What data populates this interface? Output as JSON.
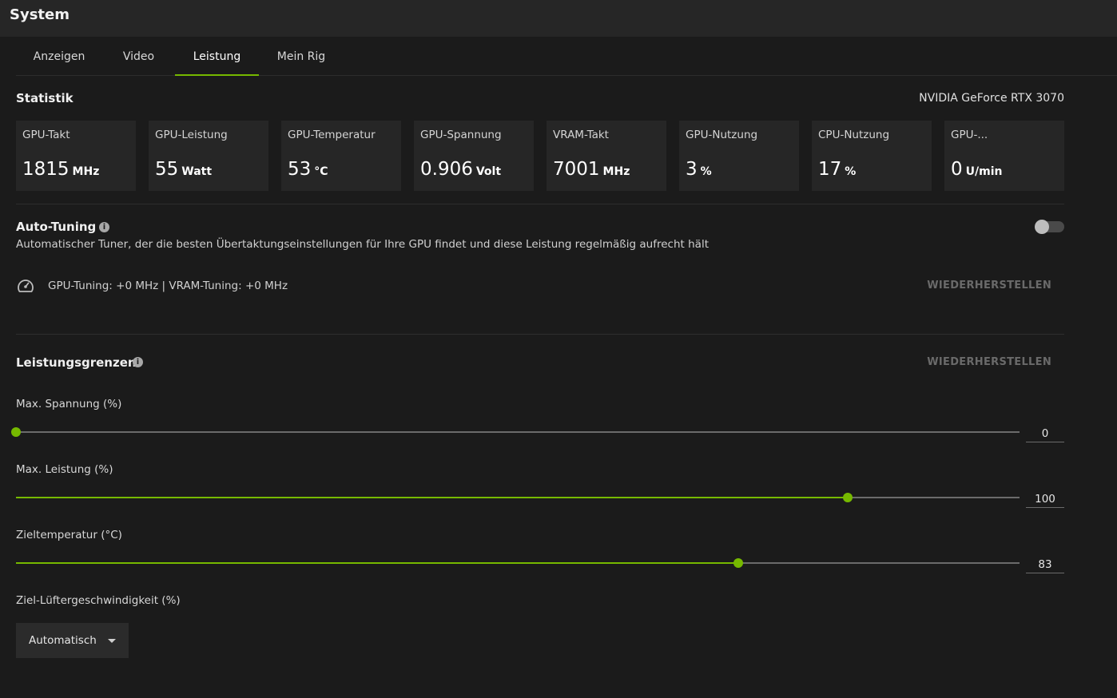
{
  "window": {
    "title": "System"
  },
  "tabs": [
    {
      "label": "Anzeigen",
      "active": false
    },
    {
      "label": "Video",
      "active": false
    },
    {
      "label": "Leistung",
      "active": true
    },
    {
      "label": "Mein Rig",
      "active": false
    }
  ],
  "stats": {
    "title": "Statistik",
    "gpu_name": "NVIDIA GeForce RTX 3070",
    "cards": [
      {
        "label": "GPU-Takt",
        "value": "1815",
        "unit": "MHz"
      },
      {
        "label": "GPU-Leistung",
        "value": "55",
        "unit": "Watt"
      },
      {
        "label": "GPU-Temperatur",
        "value": "53",
        "unit": "°C"
      },
      {
        "label": "GPU-Spannung",
        "value": "0.906",
        "unit": "Volt"
      },
      {
        "label": "VRAM-Takt",
        "value": "7001",
        "unit": "MHz"
      },
      {
        "label": "GPU-Nutzung",
        "value": "3",
        "unit": "%"
      },
      {
        "label": "CPU-Nutzung",
        "value": "17",
        "unit": "%"
      },
      {
        "label": "GPU-...",
        "value": "0",
        "unit": "U/min"
      }
    ]
  },
  "auto_tuning": {
    "title": "Auto-Tuning",
    "description": "Automatischer Tuner, der die besten Übertaktungseinstellungen für Ihre GPU findet und diese Leistung regelmäßig aufrecht hält",
    "enabled": false,
    "status": "GPU-Tuning: +0 MHz   |  VRAM-Tuning: +0 MHz",
    "restore_label": "WIEDERHERSTELLEN"
  },
  "limits": {
    "title": "Leistungsgrenzen",
    "restore_label": "WIEDERHERSTELLEN",
    "sliders": [
      {
        "label": "Max. Spannung (%)",
        "value": "0",
        "fraction": 0.0
      },
      {
        "label": "Max. Leistung (%)",
        "value": "100",
        "fraction": 0.829
      },
      {
        "label": "Zieltemperatur (°C)",
        "value": "83",
        "fraction": 0.72
      }
    ],
    "fan": {
      "label": "Ziel-Lüftergeschwindigkeit (%)",
      "selected": "Automatisch"
    }
  },
  "colors": {
    "accent": "#76b900",
    "background": "#1b1b1b",
    "card": "#262626"
  },
  "icons": {
    "info": "info-icon",
    "gauge": "speedometer-icon",
    "dropdown": "chevron-down-icon"
  }
}
